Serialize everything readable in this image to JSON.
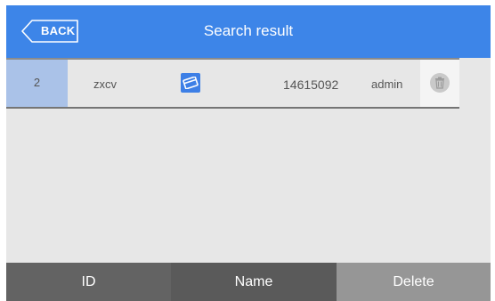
{
  "header": {
    "back_label": "BACK",
    "title": "Search result"
  },
  "rows": [
    {
      "id": "2",
      "name": "zxcv",
      "type_icon": "card-icon",
      "number": "14615092",
      "user": "admin",
      "action_icon": "trash-icon"
    }
  ],
  "footer": {
    "id_label": "ID",
    "name_label": "Name",
    "delete_label": "Delete"
  },
  "colors": {
    "header_bg": "#3d85e8",
    "selected_cell": "#aac2e8",
    "background": "#e7e7e7"
  }
}
